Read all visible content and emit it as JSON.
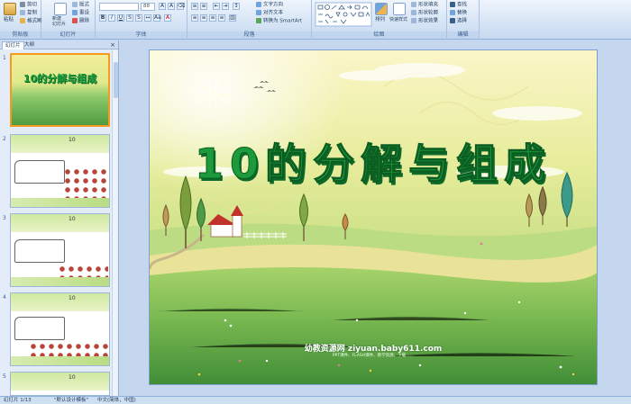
{
  "ribbon": {
    "clipboard": {
      "paste": "粘贴",
      "cut": "剪切",
      "copy": "复制",
      "format_painter": "格式刷",
      "label": "剪贴板"
    },
    "slides": {
      "new_slide": "新建\n幻灯片",
      "layout": "版式",
      "reset": "重设",
      "delete": "删除",
      "label": "幻灯片"
    },
    "font": {
      "font_name": "",
      "font_size": "88",
      "label": "字体"
    },
    "paragraph": {
      "text_direction": "文字方向",
      "align_text": "对齐文本",
      "smartart": "转换为 SmartArt",
      "label": "段落"
    },
    "drawing": {
      "arrange": "排列",
      "quick_styles": "快速样式",
      "shape_fill": "形状填充",
      "shape_outline": "形状轮廓",
      "shape_effects": "形状效果",
      "label": "绘图"
    },
    "editing": {
      "find": "查找",
      "replace": "替换",
      "select": "选择",
      "label": "编辑"
    }
  },
  "leftpane": {
    "tab_slides": "幻灯片",
    "tab_outline": "大纲",
    "close": "×",
    "slide_numbers": [
      "1",
      "2",
      "3",
      "4",
      "5"
    ],
    "thumb_title": "10的分解与组成",
    "thumb_top_number": "10"
  },
  "slide": {
    "title": "10的分解与组成",
    "watermark": "幼教资源网 ziyuan.baby611.com",
    "watermark_sub": "PPT课件、FLASH课件、教学资源、下载……"
  },
  "status": {
    "slide_info": "幻灯片 1/13",
    "theme": "\"默认设计模板\"",
    "language": "中文(简体，中国)"
  },
  "colors": {
    "accent": "#f59b22",
    "title_green": "#1d9a3c",
    "ribbon_bg": "#d6e4f5"
  }
}
